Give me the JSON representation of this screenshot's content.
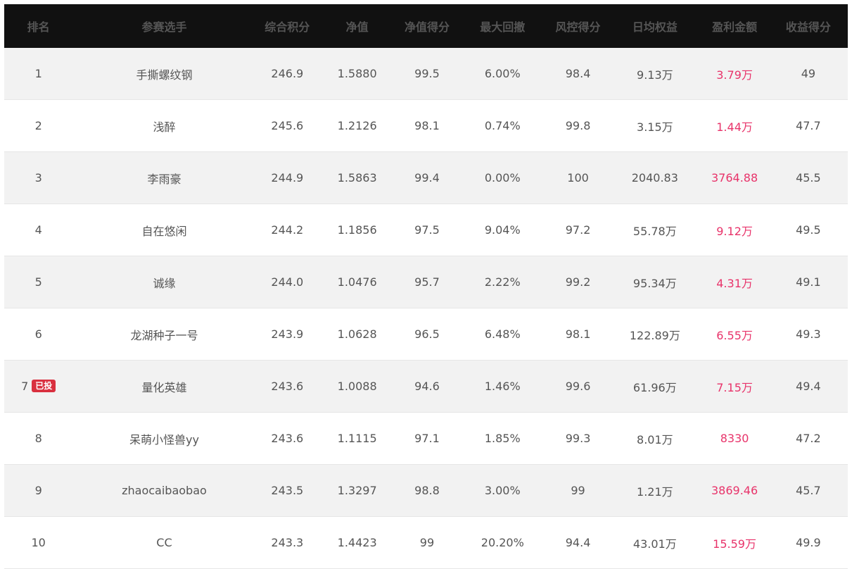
{
  "table": {
    "headers": {
      "rank": "排名",
      "player": "参赛选手",
      "score": "综合积分",
      "nav": "净值",
      "nav_score": "净值得分",
      "max_drawdown": "最大回撤",
      "risk_score": "风控得分",
      "daily_equity": "日均权益",
      "profit": "盈利金额",
      "return_score": "收益得分"
    },
    "rows": [
      {
        "rank": "1",
        "badge": "",
        "player": "手撕螺纹钢",
        "score": "246.9",
        "nav": "1.5880",
        "nav_score": "99.5",
        "max_drawdown": "6.00%",
        "risk_score": "98.4",
        "daily_equity": "9.13万",
        "profit": "3.79万",
        "return_score": "49"
      },
      {
        "rank": "2",
        "badge": "",
        "player": "浅醉",
        "score": "245.6",
        "nav": "1.2126",
        "nav_score": "98.1",
        "max_drawdown": "0.74%",
        "risk_score": "99.8",
        "daily_equity": "3.15万",
        "profit": "1.44万",
        "return_score": "47.7"
      },
      {
        "rank": "3",
        "badge": "",
        "player": "李雨豪",
        "score": "244.9",
        "nav": "1.5863",
        "nav_score": "99.4",
        "max_drawdown": "0.00%",
        "risk_score": "100",
        "daily_equity": "2040.83",
        "profit": "3764.88",
        "return_score": "45.5"
      },
      {
        "rank": "4",
        "badge": "",
        "player": "自在悠闲",
        "score": "244.2",
        "nav": "1.1856",
        "nav_score": "97.5",
        "max_drawdown": "9.04%",
        "risk_score": "97.2",
        "daily_equity": "55.78万",
        "profit": "9.12万",
        "return_score": "49.5"
      },
      {
        "rank": "5",
        "badge": "",
        "player": "诚缘",
        "score": "244.0",
        "nav": "1.0476",
        "nav_score": "95.7",
        "max_drawdown": "2.22%",
        "risk_score": "99.2",
        "daily_equity": "95.34万",
        "profit": "4.31万",
        "return_score": "49.1"
      },
      {
        "rank": "6",
        "badge": "",
        "player": "龙湖种子一号",
        "score": "243.9",
        "nav": "1.0628",
        "nav_score": "96.5",
        "max_drawdown": "6.48%",
        "risk_score": "98.1",
        "daily_equity": "122.89万",
        "profit": "6.55万",
        "return_score": "49.3"
      },
      {
        "rank": "7",
        "badge": "已投",
        "player": "量化英雄",
        "score": "243.6",
        "nav": "1.0088",
        "nav_score": "94.6",
        "max_drawdown": "1.46%",
        "risk_score": "99.6",
        "daily_equity": "61.96万",
        "profit": "7.15万",
        "return_score": "49.4"
      },
      {
        "rank": "8",
        "badge": "",
        "player": "呆萌小怪兽yy",
        "score": "243.6",
        "nav": "1.1115",
        "nav_score": "97.1",
        "max_drawdown": "1.85%",
        "risk_score": "99.3",
        "daily_equity": "8.01万",
        "profit": "8330",
        "return_score": "47.2"
      },
      {
        "rank": "9",
        "badge": "",
        "player": "zhaocaibaobao",
        "score": "243.5",
        "nav": "1.3297",
        "nav_score": "98.8",
        "max_drawdown": "3.00%",
        "risk_score": "99",
        "daily_equity": "1.21万",
        "profit": "3869.46",
        "return_score": "45.7"
      },
      {
        "rank": "10",
        "badge": "",
        "player": "CC",
        "score": "243.3",
        "nav": "1.4423",
        "nav_score": "99",
        "max_drawdown": "20.20%",
        "risk_score": "94.4",
        "daily_equity": "43.01万",
        "profit": "15.59万",
        "return_score": "49.9"
      }
    ]
  },
  "colors": {
    "header_bg": "#111111",
    "row_alt_bg": "#f2f2f2",
    "profit_text": "#e8336a",
    "badge_bg": "#d9303f"
  }
}
